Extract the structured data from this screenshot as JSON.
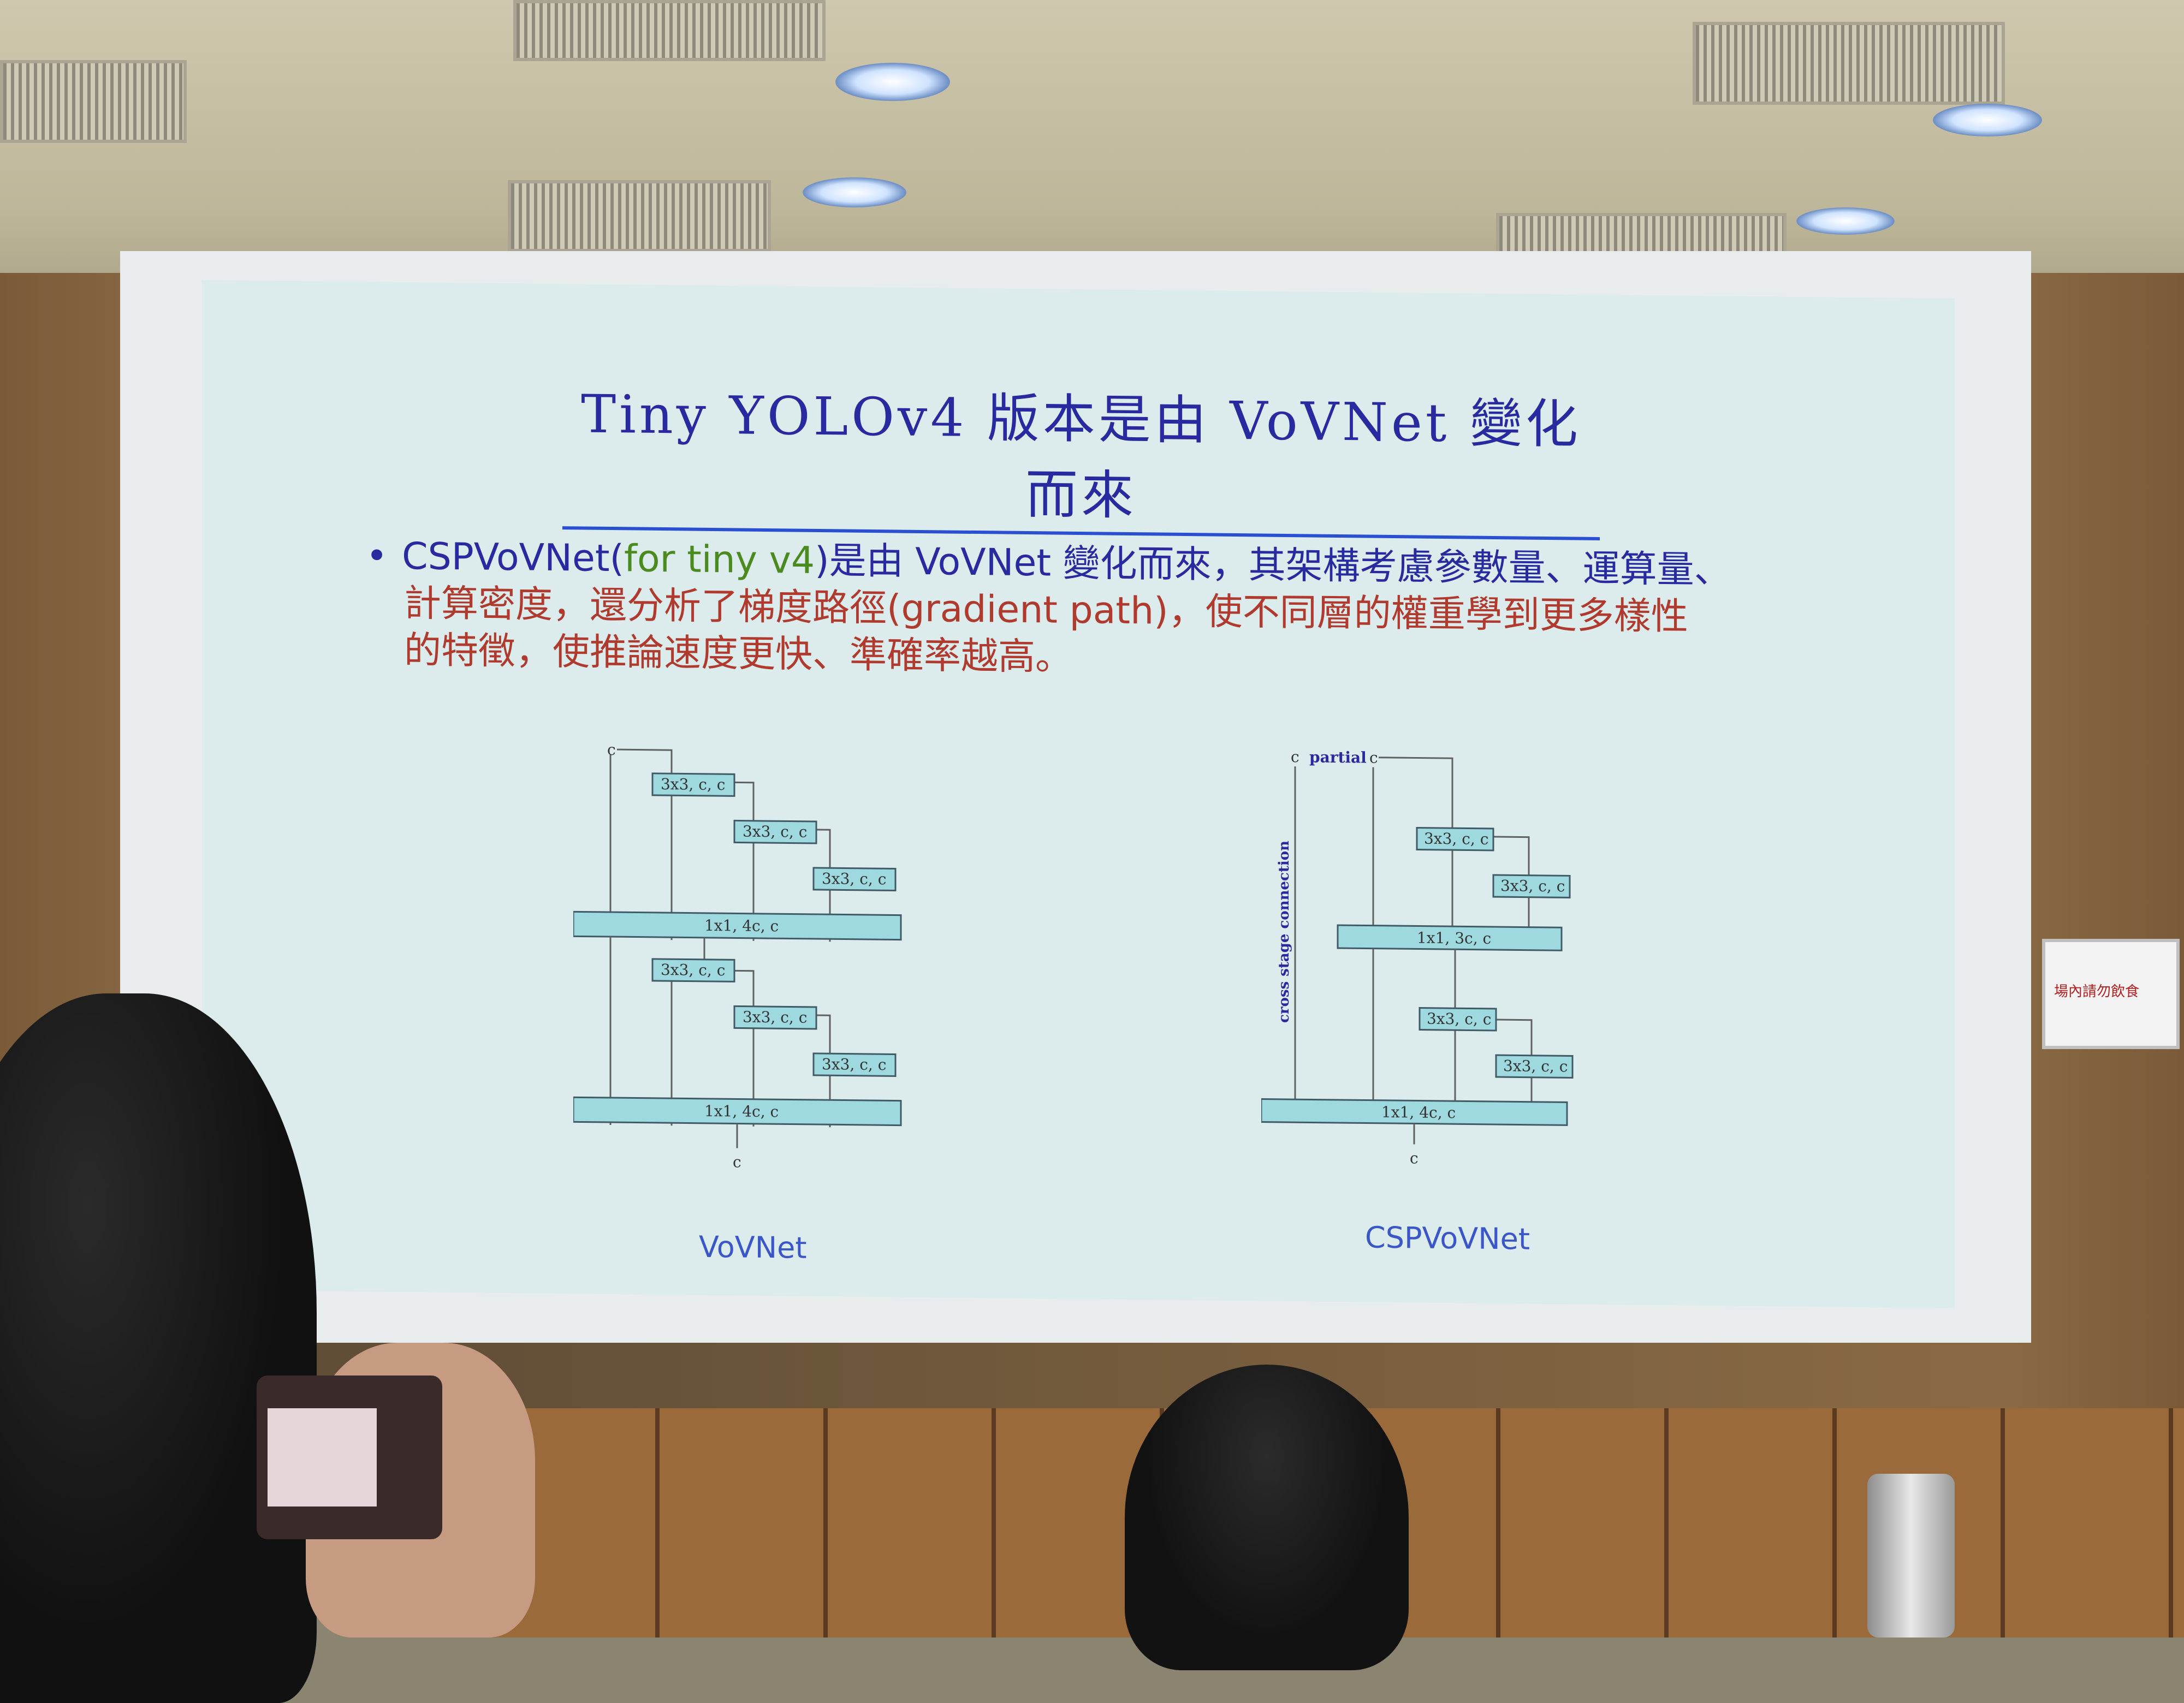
{
  "slide": {
    "title": "Tiny YOLOv4 版本是由 VoVNet 變化而來",
    "bullet": {
      "blue_prefix": "CSPVoVNet(",
      "green_text": "for tiny v4",
      "blue_suffix": ")是由 VoVNet 變化而來，其架構考慮參數量、運算量、",
      "rest_line2": "計算密度，還分析了梯度路徑(gradient path)，使不同層的權重學到更多樣性",
      "rest_line3": "的特徵，使推論速度更快、準確率越高。"
    },
    "left_diagram": {
      "caption": "VoVNet",
      "input_label": "c",
      "output_label": "c",
      "blocks": [
        "3x3, c, c",
        "3x3, c, c",
        "3x3, c, c",
        "1x1, 4c, c",
        "3x3, c, c",
        "3x3, c, c",
        "3x3, c, c",
        "1x1, 4c, c"
      ]
    },
    "right_diagram": {
      "caption": "CSPVoVNet",
      "partial_label": "partial",
      "input_left": "c",
      "input_right": "c",
      "output_label": "c",
      "side_label": "cross stage connection",
      "blocks": [
        "3x3, c, c",
        "3x3, c, c",
        "1x1, 3c, c",
        "3x3, c, c",
        "3x3, c, c",
        "1x1, 4c, c"
      ]
    }
  },
  "poster": {
    "text": "場內請勿飲食"
  }
}
